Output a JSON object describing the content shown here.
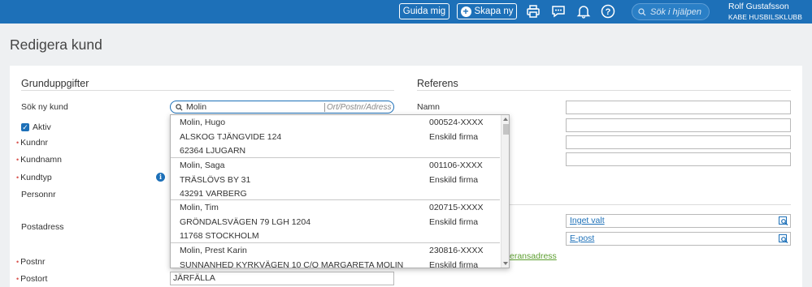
{
  "topbar": {
    "guida_label": "Guida mig",
    "skapa_label": "Skapa ny",
    "help_search_placeholder": "Sök i hjälpen",
    "user_name": "Rolf Gustafsson",
    "user_org": "KABE HUSBILSKLUBB",
    "icons": [
      "printer-icon",
      "chat-icon",
      "bell-icon",
      "help-icon",
      "search-icon"
    ],
    "color": "#1d70b8"
  },
  "page": {
    "title": "Redigera kund"
  },
  "grunduppgifter": {
    "heading": "Grunduppgifter",
    "sok_label": "Sök ny kund",
    "sok_value": "Molin",
    "sok_placeholder": "Ort/Postnr/Adress",
    "aktiv_label": "Aktiv",
    "aktiv_checked": true,
    "kundnr_label": "Kundnr",
    "kundnamn_label": "Kundnamn",
    "kundtyp_label": "Kundtyp",
    "personnr_label": "Personnr",
    "postadress_label": "Postadress",
    "postnr_label": "Postnr",
    "postort_label": "Postort",
    "postort_value": "JÄRFÄLLA"
  },
  "referens": {
    "heading": "Referens",
    "namn_label": "Namn",
    "link1": "Inget valt",
    "link2": "E-post",
    "green_link_partial": "eransadress"
  },
  "dropdown": {
    "items": [
      {
        "name": "Molin, Hugo",
        "id": "000524-XXXX",
        "street": "ALSKOG TJÄNGVIDE 124",
        "type": "Enskild firma",
        "city": "62364 LJUGARN"
      },
      {
        "name": "Molin, Saga",
        "id": "001106-XXXX",
        "street": "TRÄSLÖVS BY 31",
        "type": "Enskild firma",
        "city": "43291 VARBERG"
      },
      {
        "name": "Molin, Tim",
        "id": "020715-XXXX",
        "street": "GRÖNDALSVÄGEN 79 LGH 1204",
        "type": "Enskild firma",
        "city": "11768 STOCKHOLM"
      },
      {
        "name": "Molin, Prest Karin",
        "id": "230816-XXXX",
        "street": "SUNNANHED KYRKVÄGEN 10 C/O MARGARETA MOLIN",
        "type": "Enskild firma",
        "city": ""
      }
    ]
  }
}
